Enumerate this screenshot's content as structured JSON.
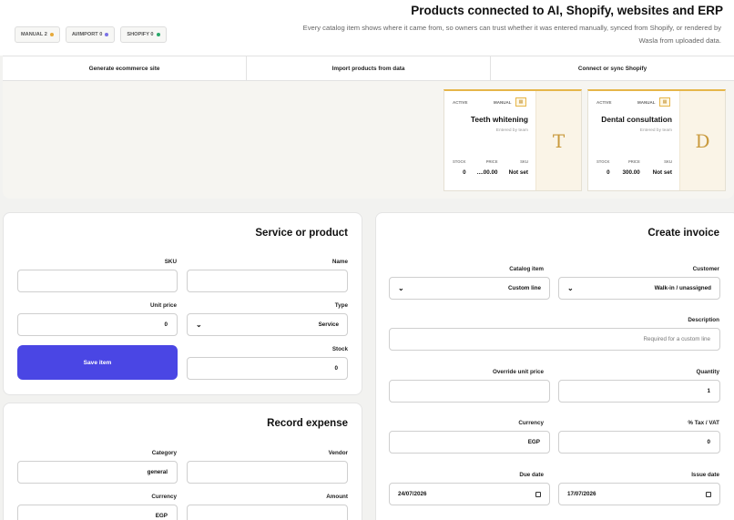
{
  "header": {
    "title": "Products connected to AI, Shopify, websites and ERP",
    "subtitle": "Every catalog item shows where it came from, so owners can trust whether it was entered manually, synced from Shopify, or rendered by Wasla from uploaded data.",
    "badges": [
      {
        "label": "MANUAL 2",
        "color": "#e6a93a"
      },
      {
        "label": "AI/IMPORT 0",
        "color": "#7b73e6"
      },
      {
        "label": "SHOPIFY 0",
        "color": "#2aa96b"
      }
    ]
  },
  "tabs": [
    {
      "label": "Generate ecommerce site"
    },
    {
      "label": "Import products from data"
    },
    {
      "label": "Connect or sync Shopify"
    }
  ],
  "catalog": {
    "items": [
      {
        "status": "ACTIVE",
        "source": "MANUAL",
        "name": "Teeth whitening",
        "sub": "Entered by team",
        "initial": "T",
        "stock_label": "STOCK",
        "price_label": "PRICE",
        "sku_label": "SKU",
        "stock": "0",
        "price": "....00.00",
        "sku": "Not set"
      },
      {
        "status": "ACTIVE",
        "source": "MANUAL",
        "name": "Dental consultation",
        "sub": "Entered by team",
        "initial": "D",
        "stock_label": "STOCK",
        "price_label": "PRICE",
        "sku_label": "SKU",
        "stock": "0",
        "price": "300.00",
        "sku": "Not set"
      }
    ]
  },
  "service_form": {
    "title": "Service or product",
    "sku_label": "SKU",
    "sku_value": "",
    "name_label": "Name",
    "name_value": "",
    "unit_price_label": "Unit price",
    "unit_price_value": "0",
    "type_label": "Type",
    "type_value": "Service",
    "stock_label": "Stock",
    "stock_value": "0",
    "save_label": "Save item"
  },
  "expense_form": {
    "title": "Record expense",
    "category_label": "Category",
    "category_value": "general",
    "vendor_label": "Vendor",
    "vendor_value": "",
    "currency_label": "Currency",
    "currency_value": "EGP",
    "amount_label": "Amount",
    "amount_value": ""
  },
  "invoice_form": {
    "title": "Create invoice",
    "catalog_label": "Catalog item",
    "catalog_value": "Custom line",
    "customer_label": "Customer",
    "customer_value": "Walk-in / unassigned",
    "description_label": "Description",
    "description_placeholder": "Required for a custom line",
    "override_label": "Override unit price",
    "override_value": "",
    "quantity_label": "Quantity",
    "quantity_value": "1",
    "currency_label": "Currency",
    "currency_value": "EGP",
    "tax_label": "% Tax / VAT",
    "tax_value": "0",
    "due_label": "Due date",
    "due_value": "24/07/2026",
    "issue_label": "Issue date",
    "issue_value": "17/07/2026"
  },
  "colors": {
    "accent": "#4a46e4",
    "gold": "#e6b64a"
  }
}
